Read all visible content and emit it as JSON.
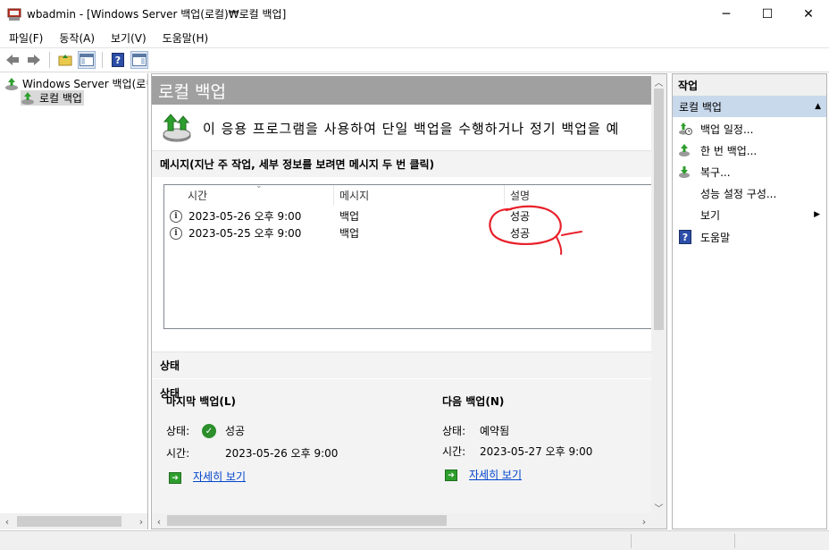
{
  "window": {
    "title": "wbadmin - [Windows Server 백업(로컬)₩로컬 백업]",
    "minimize": "─",
    "maximize": "☐",
    "close": "✕"
  },
  "menu": [
    "파일(F)",
    "동작(A)",
    "보기(V)",
    "도움말(H)"
  ],
  "tree": {
    "root": "Windows Server 백업(로컬)",
    "child": "로컬 백업"
  },
  "center": {
    "header": "로컬 백업",
    "intro": "이 응용 프로그램을 사용하여 단일 백업을 수행하거나 정기 백업을 예",
    "messages_section": "메시지(지난 주 작업, 세부 정보를 보려면 메시지 두 번 클릭)",
    "columns": [
      "시간",
      "메시지",
      "설명"
    ],
    "rows": [
      {
        "time": "2023-05-26 오후 9:00",
        "message": "백업",
        "description": "성공"
      },
      {
        "time": "2023-05-25 오후 9:00",
        "message": "백업",
        "description": "성공"
      }
    ],
    "status_section": "상태",
    "last_backup": {
      "title": "마지막 백업(L)",
      "status_label": "상태:",
      "status_value": "성공",
      "time_label": "시간:",
      "time_value": "2023-05-26 오후 9:00",
      "details_link": "자세히 보기"
    },
    "next_backup": {
      "title": "다음 백업(N)",
      "status_label": "상태:",
      "status_value": "예약됨",
      "time_label": "시간:",
      "time_value": "2023-05-27 오후 9:00",
      "details_link": "자세히 보기"
    }
  },
  "actions": {
    "header": "작업",
    "group": "로컬 백업",
    "items": [
      "백업 일정...",
      "한 번 백업...",
      "복구...",
      "성능 설정 구성...",
      "보기",
      "도움말"
    ]
  },
  "colors": {
    "header_gray": "#a0a0a0",
    "selection_blue": "#c9d9ec",
    "annotation_red": "#e8202a",
    "link_blue": "#0044cc"
  }
}
